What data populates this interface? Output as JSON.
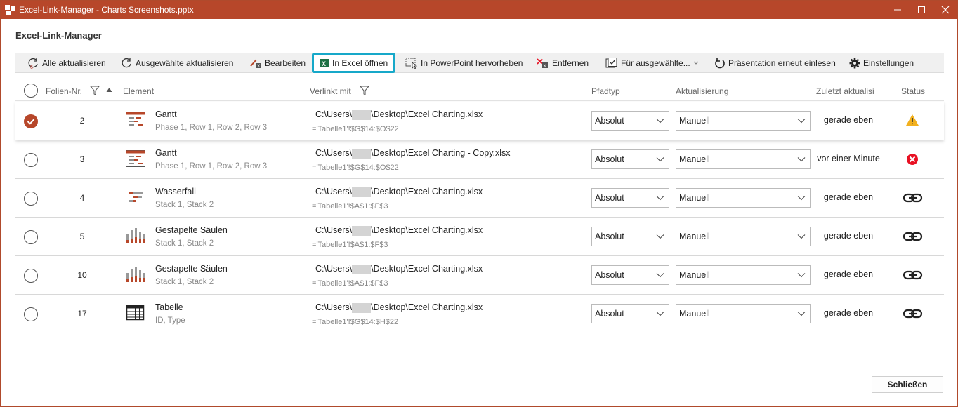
{
  "window": {
    "title": "Excel-Link-Manager - Charts Screenshots.pptx"
  },
  "heading": "Excel-Link-Manager",
  "toolbar": {
    "refresh_all": "Alle aktualisieren",
    "refresh_selected": "Ausgewählte aktualisieren",
    "edit": "Bearbeiten",
    "open_excel": "In Excel öffnen",
    "highlight_ppt": "In PowerPoint hervorheben",
    "remove": "Entfernen",
    "for_selected": "Für ausgewählte...",
    "reload": "Präsentation erneut einlesen",
    "settings": "Einstellungen"
  },
  "columns": {
    "slide": "Folien-Nr.",
    "element": "Element",
    "linked": "Verlinkt mit",
    "pathtype": "Pfadtyp",
    "update": "Aktualisierung",
    "last": "Zuletzt aktualisi",
    "status": "Status"
  },
  "rows": [
    {
      "checked": true,
      "slide": "2",
      "icon": "gantt-icon",
      "name": "Gantt",
      "sub": "Phase 1, Row 1, Row 2, Row 3",
      "path_pre": "C:\\Users\\",
      "path_post": "\\Desktop\\Excel Charting.xlsx",
      "ref": "='Tabelle1'!$G$14:$O$22",
      "pathtype": "Absolut",
      "update": "Manuell",
      "last": "gerade eben",
      "status": "warning-icon"
    },
    {
      "checked": false,
      "slide": "3",
      "icon": "gantt-icon",
      "name": "Gantt",
      "sub": "Phase 1, Row 1, Row 2, Row 3",
      "path_pre": "C:\\Users\\",
      "path_post": "\\Desktop\\Excel Charting - Copy.xlsx",
      "ref": "='Tabelle1'!$G$14:$O$22",
      "pathtype": "Absolut",
      "update": "Manuell",
      "last": "vor einer Minute",
      "status": "error-icon"
    },
    {
      "checked": false,
      "slide": "4",
      "icon": "waterfall-icon",
      "name": "Wasserfall",
      "sub": "Stack 1, Stack 2",
      "path_pre": "C:\\Users\\",
      "path_post": "\\Desktop\\Excel Charting.xlsx",
      "ref": "='Tabelle1'!$A$1:$F$3",
      "pathtype": "Absolut",
      "update": "Manuell",
      "last": "gerade eben",
      "status": "link-icon"
    },
    {
      "checked": false,
      "slide": "5",
      "icon": "stacked-columns-icon",
      "name": "Gestapelte Säulen",
      "sub": "Stack 1, Stack 2",
      "path_pre": "C:\\Users\\",
      "path_post": "\\Desktop\\Excel Charting.xlsx",
      "ref": "='Tabelle1'!$A$1:$F$3",
      "pathtype": "Absolut",
      "update": "Manuell",
      "last": "gerade eben",
      "status": "link-icon"
    },
    {
      "checked": false,
      "slide": "10",
      "icon": "stacked-columns-icon",
      "name": "Gestapelte Säulen",
      "sub": "Stack 1, Stack 2",
      "path_pre": "C:\\Users\\",
      "path_post": "\\Desktop\\Excel Charting.xlsx",
      "ref": "='Tabelle1'!$A$1:$F$3",
      "pathtype": "Absolut",
      "update": "Manuell",
      "last": "gerade eben",
      "status": "link-icon"
    },
    {
      "checked": false,
      "slide": "17",
      "icon": "table-icon",
      "name": "Tabelle",
      "sub": "ID, Type",
      "path_pre": "C:\\Users\\",
      "path_post": "\\Desktop\\Excel Charting.xlsx",
      "ref": "='Tabelle1'!$G$14:$H$22",
      "pathtype": "Absolut",
      "update": "Manuell",
      "last": "gerade eben",
      "status": "link-icon"
    }
  ],
  "footer": {
    "close": "Schließen"
  },
  "colors": {
    "accent": "#b7472a",
    "highlight": "#16a8c9",
    "warning": "#f2b01e",
    "error": "#e81123"
  }
}
